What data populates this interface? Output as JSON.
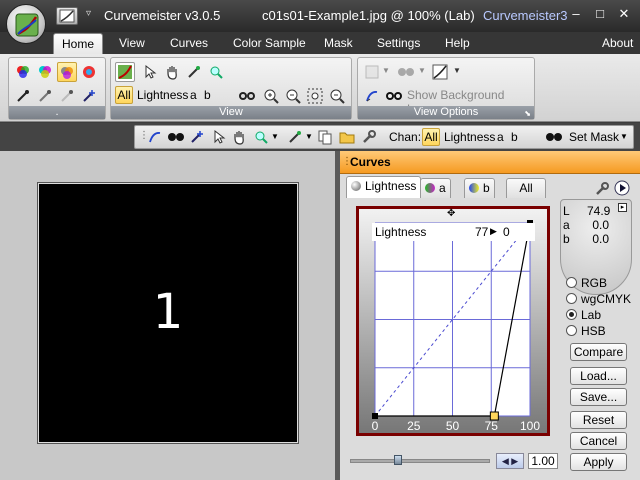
{
  "titlebar": {
    "app_name": "Curvemeister v3.0.5",
    "document": "c01s01-Example1.jpg @ 100% (Lab)",
    "app_short": "Curvemeister3",
    "minimize_glyph": "–",
    "maximize_glyph": "□",
    "close_glyph": "✕",
    "dropdown_glyph": "▿"
  },
  "ribbon_tabs": [
    "Home",
    "View",
    "Curves",
    "Color Sample",
    "Mask",
    "Settings",
    "Help"
  ],
  "about_label": "About",
  "ribbon": {
    "group1_label": ".",
    "view_group": {
      "label": "View",
      "channels": [
        "All",
        "Lightness",
        "a",
        "b"
      ]
    },
    "view_options_group": {
      "label": "View Options",
      "show_bg_layers": "Show Background Layers"
    }
  },
  "toolstrip": {
    "chan_label": "Chan:",
    "channels": [
      "All",
      "Lightness",
      "a",
      "b"
    ],
    "set_mask": "Set Mask"
  },
  "canvas": {
    "image_label": "1"
  },
  "curves": {
    "title": "Curves",
    "tabs": [
      "Lightness",
      "a",
      "b",
      "All"
    ],
    "graph_channel": "Lightness",
    "point_in": "77",
    "point_arrow": "▶",
    "point_out": "0",
    "axis_ticks": [
      "0",
      "25",
      "50",
      "75",
      "100"
    ],
    "readout": [
      {
        "label": "L",
        "value": "74.9"
      },
      {
        "label": "a",
        "value": "0.0"
      },
      {
        "label": "b",
        "value": "0.0"
      }
    ],
    "color_modes": [
      "RGB",
      "wgCMYK",
      "Lab",
      "HSB"
    ],
    "selected_mode": "Lab",
    "buttons": [
      "Compare",
      "Load...",
      "Save...",
      "Reset",
      "Cancel",
      "Apply"
    ],
    "zoom_value": "1.00",
    "curve_points": [
      [
        0,
        0
      ],
      [
        77,
        0
      ],
      [
        100,
        100
      ]
    ]
  },
  "colors": {
    "accent_orange": "#f59a21",
    "selection_gold": "#ffd65c",
    "graph_border": "#7a0000",
    "grid_blue": "#6a6ad8"
  }
}
